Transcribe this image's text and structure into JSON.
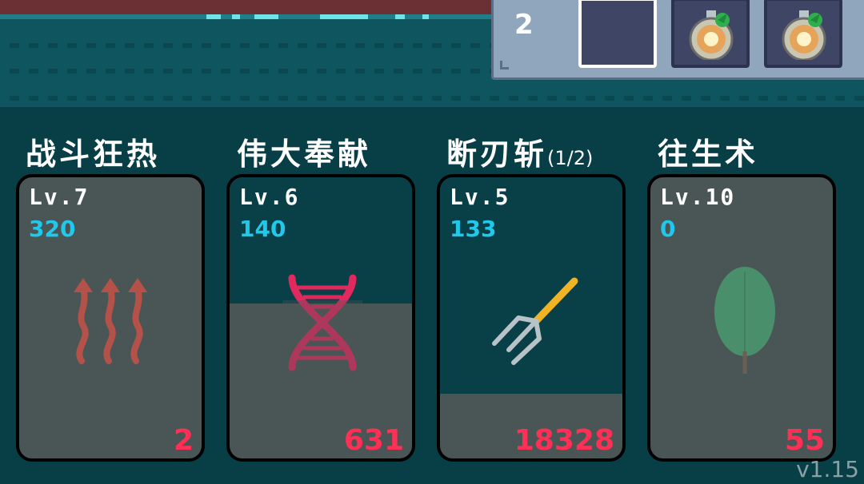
{
  "inventory": {
    "count": "2",
    "slots": [
      {
        "item": "empty",
        "selected": true
      },
      {
        "item": "potion-icon",
        "selected": false
      },
      {
        "item": "potion-icon",
        "selected": false
      }
    ]
  },
  "skills": [
    {
      "title": "战斗狂热",
      "suffix": "",
      "level": "Lv.7",
      "value": "320",
      "count": "2",
      "icon": "heat-waves-icon",
      "fill_percent": 0
    },
    {
      "title": "伟大奉献",
      "suffix": "",
      "level": "Lv.6",
      "value": "140",
      "count": "631",
      "icon": "dna-icon",
      "fill_percent": 45
    },
    {
      "title": "断刃斩",
      "suffix": "(1/2)",
      "level": "Lv.5",
      "value": "133",
      "count": "18328",
      "icon": "pitchfork-icon",
      "fill_percent": 77
    },
    {
      "title": "往生术",
      "suffix": "",
      "level": "Lv.10",
      "value": "0",
      "count": "55",
      "icon": "leaf-icon",
      "fill_percent": 0
    }
  ],
  "version": "v1.15",
  "colors": {
    "level_value": "#20c8ec",
    "count": "#ff2f55",
    "card_fill": "#093f47"
  }
}
